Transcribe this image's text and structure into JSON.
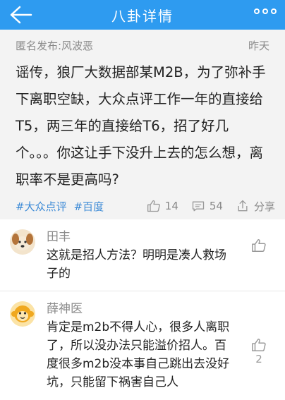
{
  "header": {
    "title": "八卦详情",
    "back_icon": "back-arrow-icon",
    "more_icon": "more-dots-icon"
  },
  "post": {
    "author_line": "匿名发布:风波恶",
    "time": "昨天",
    "content": "谣传，狼厂大数据部某M2B，为了弥补手下离职空缺，大众点评工作一年的直接给T5，两三年的直接给T6，招了好几个。。。你这让手下没升上去的怎么想，离职率不是更高吗?",
    "tags": [
      "#大众点评",
      "#百度"
    ],
    "like_count": "14",
    "comment_count": "54",
    "share_label": "分享"
  },
  "comments": [
    {
      "name": "田丰",
      "avatar_icon": "dog-avatar-icon",
      "text": "这就是招人方法？明明是凑人救场子的",
      "likes": ""
    },
    {
      "name": "薛神医",
      "avatar_icon": "monkey-avatar-icon",
      "text": "肯定是m2b不得人心，很多人离职了，所以没办法只能溢价招人。百度很多m2b没本事自己跳出去没好坑，只能留下祸害自己人",
      "likes": "2"
    }
  ],
  "colors": {
    "header_bg": "#2e9bf0",
    "tag": "#3a89d6",
    "post_bg": "#f3f3f3"
  }
}
